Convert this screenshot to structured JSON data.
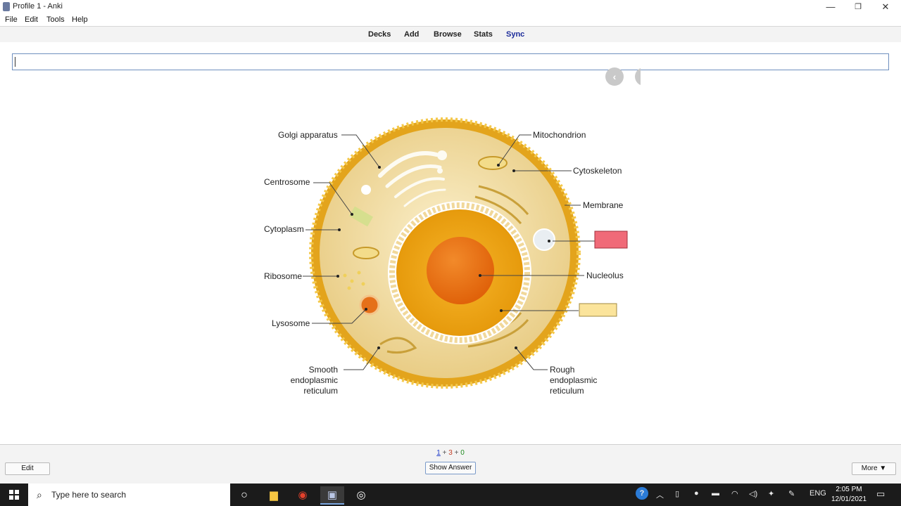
{
  "window": {
    "title": "Profile 1 - Anki",
    "minimize": "—",
    "restore": "❐",
    "close": "✕"
  },
  "menu": {
    "file": "File",
    "edit": "Edit",
    "tools": "Tools",
    "help": "Help"
  },
  "toolbar": {
    "decks": "Decks",
    "add": "Add",
    "browse": "Browse",
    "stats": "Stats",
    "sync": "Sync"
  },
  "card": {
    "answer_value": "",
    "labels": {
      "golgi": "Golgi apparatus",
      "mitochondrion": "Mitochondrion",
      "cytoskeleton": "Cytoskeleton",
      "centrosome": "Centrosome",
      "membrane": "Membrane",
      "cytoplasm": "Cytoplasm",
      "ribosome": "Ribosome",
      "nucleolus": "Nucleolus",
      "lysosome": "Lysosome",
      "smooth_er": [
        "Smooth",
        "endoplasmic",
        "reticulum"
      ],
      "rough_er": [
        "Rough",
        "endoplasmic",
        "reticulum"
      ]
    },
    "occlusion_colors": {
      "active": "#f06a78",
      "other": "#fbe49b"
    },
    "cell_colors": {
      "membrane": "#e8a81e",
      "cytoplasm": "#f6e2a8",
      "nucleus": "#f2a40f",
      "nucleolus": "#e8690c"
    },
    "nav": {
      "prev_icon": "‹"
    }
  },
  "bottom": {
    "counts": {
      "new": "1",
      "learning": "3",
      "review": "0",
      "separator": "+"
    },
    "edit_label": "Edit",
    "show_answer_label": "Show Answer",
    "more_label": "More ▼"
  },
  "taskbar": {
    "search_placeholder": "Type here to search",
    "language": "ENG",
    "time": "2:05 PM",
    "date": "12/01/2021"
  }
}
